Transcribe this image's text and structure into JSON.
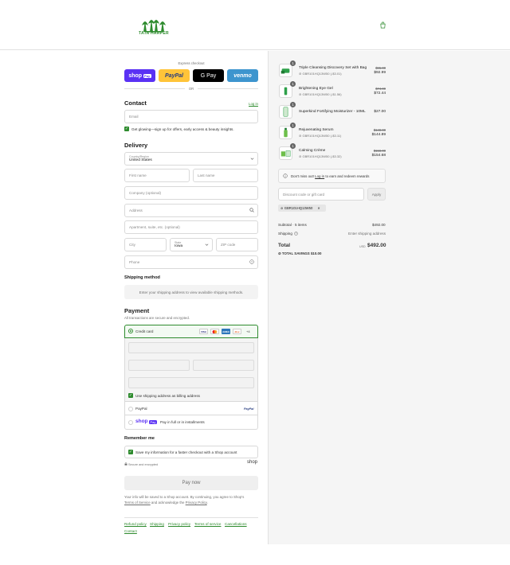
{
  "brand": {
    "name": "TATA HARPER"
  },
  "express": {
    "label": "Express checkout",
    "or": "OR",
    "shop_pay": "shop",
    "shop_pay_badge": "Pay",
    "paypal": "PayPal",
    "gpay": "G Pay",
    "venmo": "venmo"
  },
  "contact": {
    "title": "Contact",
    "login": "Log in",
    "email_placeholder": "Email",
    "newsletter": "Get glowing—sign up for offers, early access & beauty insights."
  },
  "delivery": {
    "title": "Delivery",
    "country_label": "Country/Region",
    "country_value": "United States",
    "first_name": "First name",
    "last_name": "Last name",
    "company": "Company (optional)",
    "address": "Address",
    "apartment": "Apartment, suite, etc. (optional)",
    "city": "City",
    "state_label": "State",
    "state_value": "Iowa",
    "zip": "ZIP code",
    "phone": "Phone"
  },
  "shipping_method": {
    "title": "Shipping method",
    "info": "Enter your shipping address to view available shipping methods."
  },
  "payment": {
    "title": "Payment",
    "subtitle": "All transactions are secure and encrypted.",
    "credit_card": "Credit card",
    "card_more": "+4",
    "billing_same": "Use shipping address as billing address",
    "paypal": "PayPal",
    "paypal_logo": "PayPal",
    "shop_pay": "shop",
    "shop_pay_badge": "Pay",
    "shop_pay_text": "Pay in full or in installments"
  },
  "remember": {
    "title": "Remember me",
    "save_info": "Save my information for a faster checkout with a Shop account",
    "secure": "Secure and encrypted",
    "shop": "shop"
  },
  "pay_now": "Pay now",
  "legal": {
    "line1": "Your info will be saved to a Shop account. By continuing, you agree to Shop's",
    "terms": "Terms of Service",
    "mid": " and acknowledge the ",
    "privacy": "Privacy Policy",
    "end": "."
  },
  "footer_links": [
    "Refund policy",
    "Shipping",
    "Privacy policy",
    "Terms of service",
    "Cancellations",
    "Contact"
  ],
  "cart": {
    "items": [
      {
        "qty": "1",
        "name": "Triple Cleansing Discovery Set with Bag",
        "discount": "GBR101HQ13W50 (-$3.01)",
        "old": "$95.00",
        "new": "$92.99"
      },
      {
        "qty": "1",
        "name": "Brightening Eye Gel",
        "discount": "GBR101HQ13W50 (-$1.56)",
        "old": "$74.00",
        "new": "$72.44"
      },
      {
        "qty": "1",
        "name": "Superkind Fortifying Moisturizer - 10ML",
        "discount": "",
        "old": "",
        "new": "$27.00"
      },
      {
        "qty": "1",
        "name": "Rejuvenating Serum",
        "discount": "GBR101HQ13W50 (-$3.11)",
        "old": "$148.00",
        "new": "$144.89"
      },
      {
        "qty": "1",
        "name": "Calming Crème",
        "discount": "GBR101HQ13W50 (-$3.32)",
        "old": "$158.00",
        "new": "$154.68"
      }
    ],
    "rewards": "Don't miss out!",
    "rewards_login": "Log in",
    "rewards_end": "to earn and redeem rewards",
    "discount_placeholder": "Discount code or gift card",
    "apply": "Apply",
    "code_tag": "GBR101HQ13W50",
    "subtotal_label": "Subtotal · 5 items",
    "subtotal": "$492.00",
    "shipping_label": "Shipping",
    "shipping_value": "Enter shipping address",
    "total_label": "Total",
    "currency": "USD",
    "total": "$492.00",
    "savings_label": "TOTAL SAVINGS",
    "savings": "$10.00"
  },
  "colors": {
    "accent": "#2e8b2e",
    "shop_pay": "#5a31f4",
    "paypal": "#ffc439",
    "venmo": "#3d95ce"
  }
}
